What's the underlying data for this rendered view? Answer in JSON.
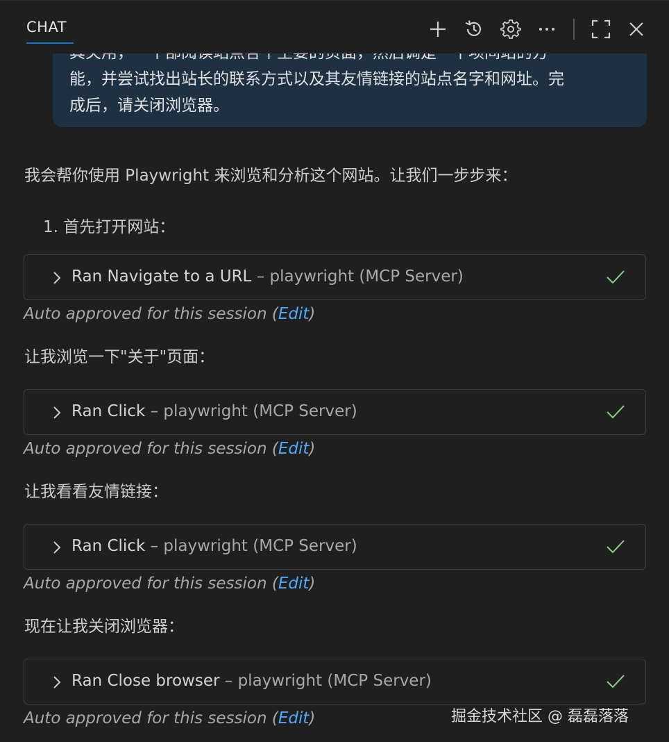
{
  "header": {
    "tab_label": "CHAT",
    "icons": [
      "plus-icon",
      "history-icon",
      "gear-icon",
      "more-icon",
      "maximize-icon",
      "close-icon"
    ]
  },
  "user_message": {
    "lines": [
      "其关用，一个部阅读站点各个主要的页面，然后调是一个项间站的方",
      "能，并尝试找出站长的联系方式以及其友情链接的站点名字和网址。完",
      "成后，请关闭浏览器。"
    ]
  },
  "response": {
    "intro": "我会帮你使用 Playwright 来浏览和分析这个网站。让我们一步步来：",
    "step1": "1. 首先打开网站：",
    "tool_calls": [
      {
        "name": "Ran Navigate to a URL",
        "source": "– playwright (MCP Server)"
      },
      {
        "name": "Ran Click",
        "source": "– playwright (MCP Server)"
      },
      {
        "name": "Ran Click",
        "source": "– playwright (MCP Server)"
      },
      {
        "name": "Ran Close browser",
        "source": "– playwright (MCP Server)"
      }
    ],
    "approved_prefix": "Auto approved for this session (",
    "approved_edit": "Edit",
    "approved_suffix": ")",
    "para_about": "让我浏览一下\"关于\"页面：",
    "para_links": "让我看看友情链接：",
    "para_close": "现在让我关闭浏览器："
  },
  "watermark": "掘金技术社区 @ 磊磊落落",
  "colors": {
    "background": "#1f1f1f",
    "accent": "#0078d4",
    "link": "#4daafc",
    "check": "#89d185",
    "user_bubble": "#1e3142"
  }
}
